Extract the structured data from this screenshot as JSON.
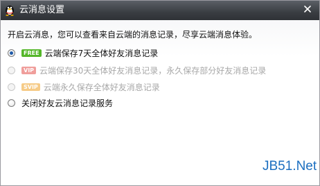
{
  "window": {
    "title": "云消息设置",
    "logo_icon": "qq-penguin-icon",
    "close_icon": "close-icon"
  },
  "intro_text": "开启云消息，您可以查看来自云端的消息记录，尽享云端消息体验。",
  "options": [
    {
      "badge": "FREE",
      "label": "云端保存7天全体好友消息记录",
      "selected": true,
      "enabled": true
    },
    {
      "badge": "VIP",
      "label": "云端保存30天全体好友消息记录，永久保存部分好友消息记录",
      "selected": false,
      "enabled": false
    },
    {
      "badge": "SVIP",
      "label": "云端永久保存全体好友消息记录",
      "selected": false,
      "enabled": false
    },
    {
      "badge": "",
      "label": "关闭好友云消息记录服务",
      "selected": false,
      "enabled": true
    }
  ],
  "watermark": "JB51.Net",
  "colors": {
    "free_badge": "#55b72a",
    "vip_badge": "#e4504b",
    "svip_badge": "#f0a126",
    "watermark": "#1c6fc0"
  }
}
